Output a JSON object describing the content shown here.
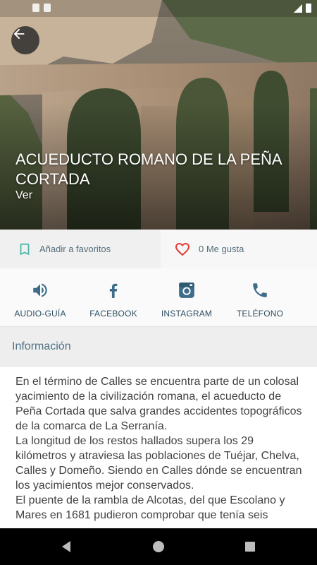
{
  "place": {
    "title": "ACUEDUCTO ROMANO DE LA PEÑA CORTADA",
    "subtitle": "Ver"
  },
  "actions": {
    "favorites_label": "Añadir a favoritos",
    "likes_label": "0 Me gusta"
  },
  "social": [
    {
      "label": "AUDIO-GUÍA",
      "icon": "speaker-icon"
    },
    {
      "label": "FACEBOOK",
      "icon": "facebook-icon"
    },
    {
      "label": "INSTAGRAM",
      "icon": "instagram-icon"
    },
    {
      "label": "TELÉFONO",
      "icon": "phone-icon"
    }
  ],
  "info": {
    "header": "Información",
    "paragraphs": [
      "En el término de Calles se encuentra parte de un colosal yacimiento de la civilización romana, el acueducto de Peña Cortada que salva grandes accidentes topográficos de la comarca de La Serranía.",
      "La longitud de los restos hallados supera los 29 kilómetros y atraviesa las poblaciones de Tuéjar, Chelva, Calles y Domeño. Siendo en Calles dónde se encuentran los yacimientos mejor conservados.",
      "El puente de la rambla de Alcotas, del que Escolano y Mares en 1681 pudieron comprobar que tenía seis"
    ]
  },
  "colors": {
    "accent_teal": "#4db6ac",
    "heart_red": "#e53935",
    "icon_blue": "#3d6d8a",
    "header_text": "#4f7184"
  }
}
